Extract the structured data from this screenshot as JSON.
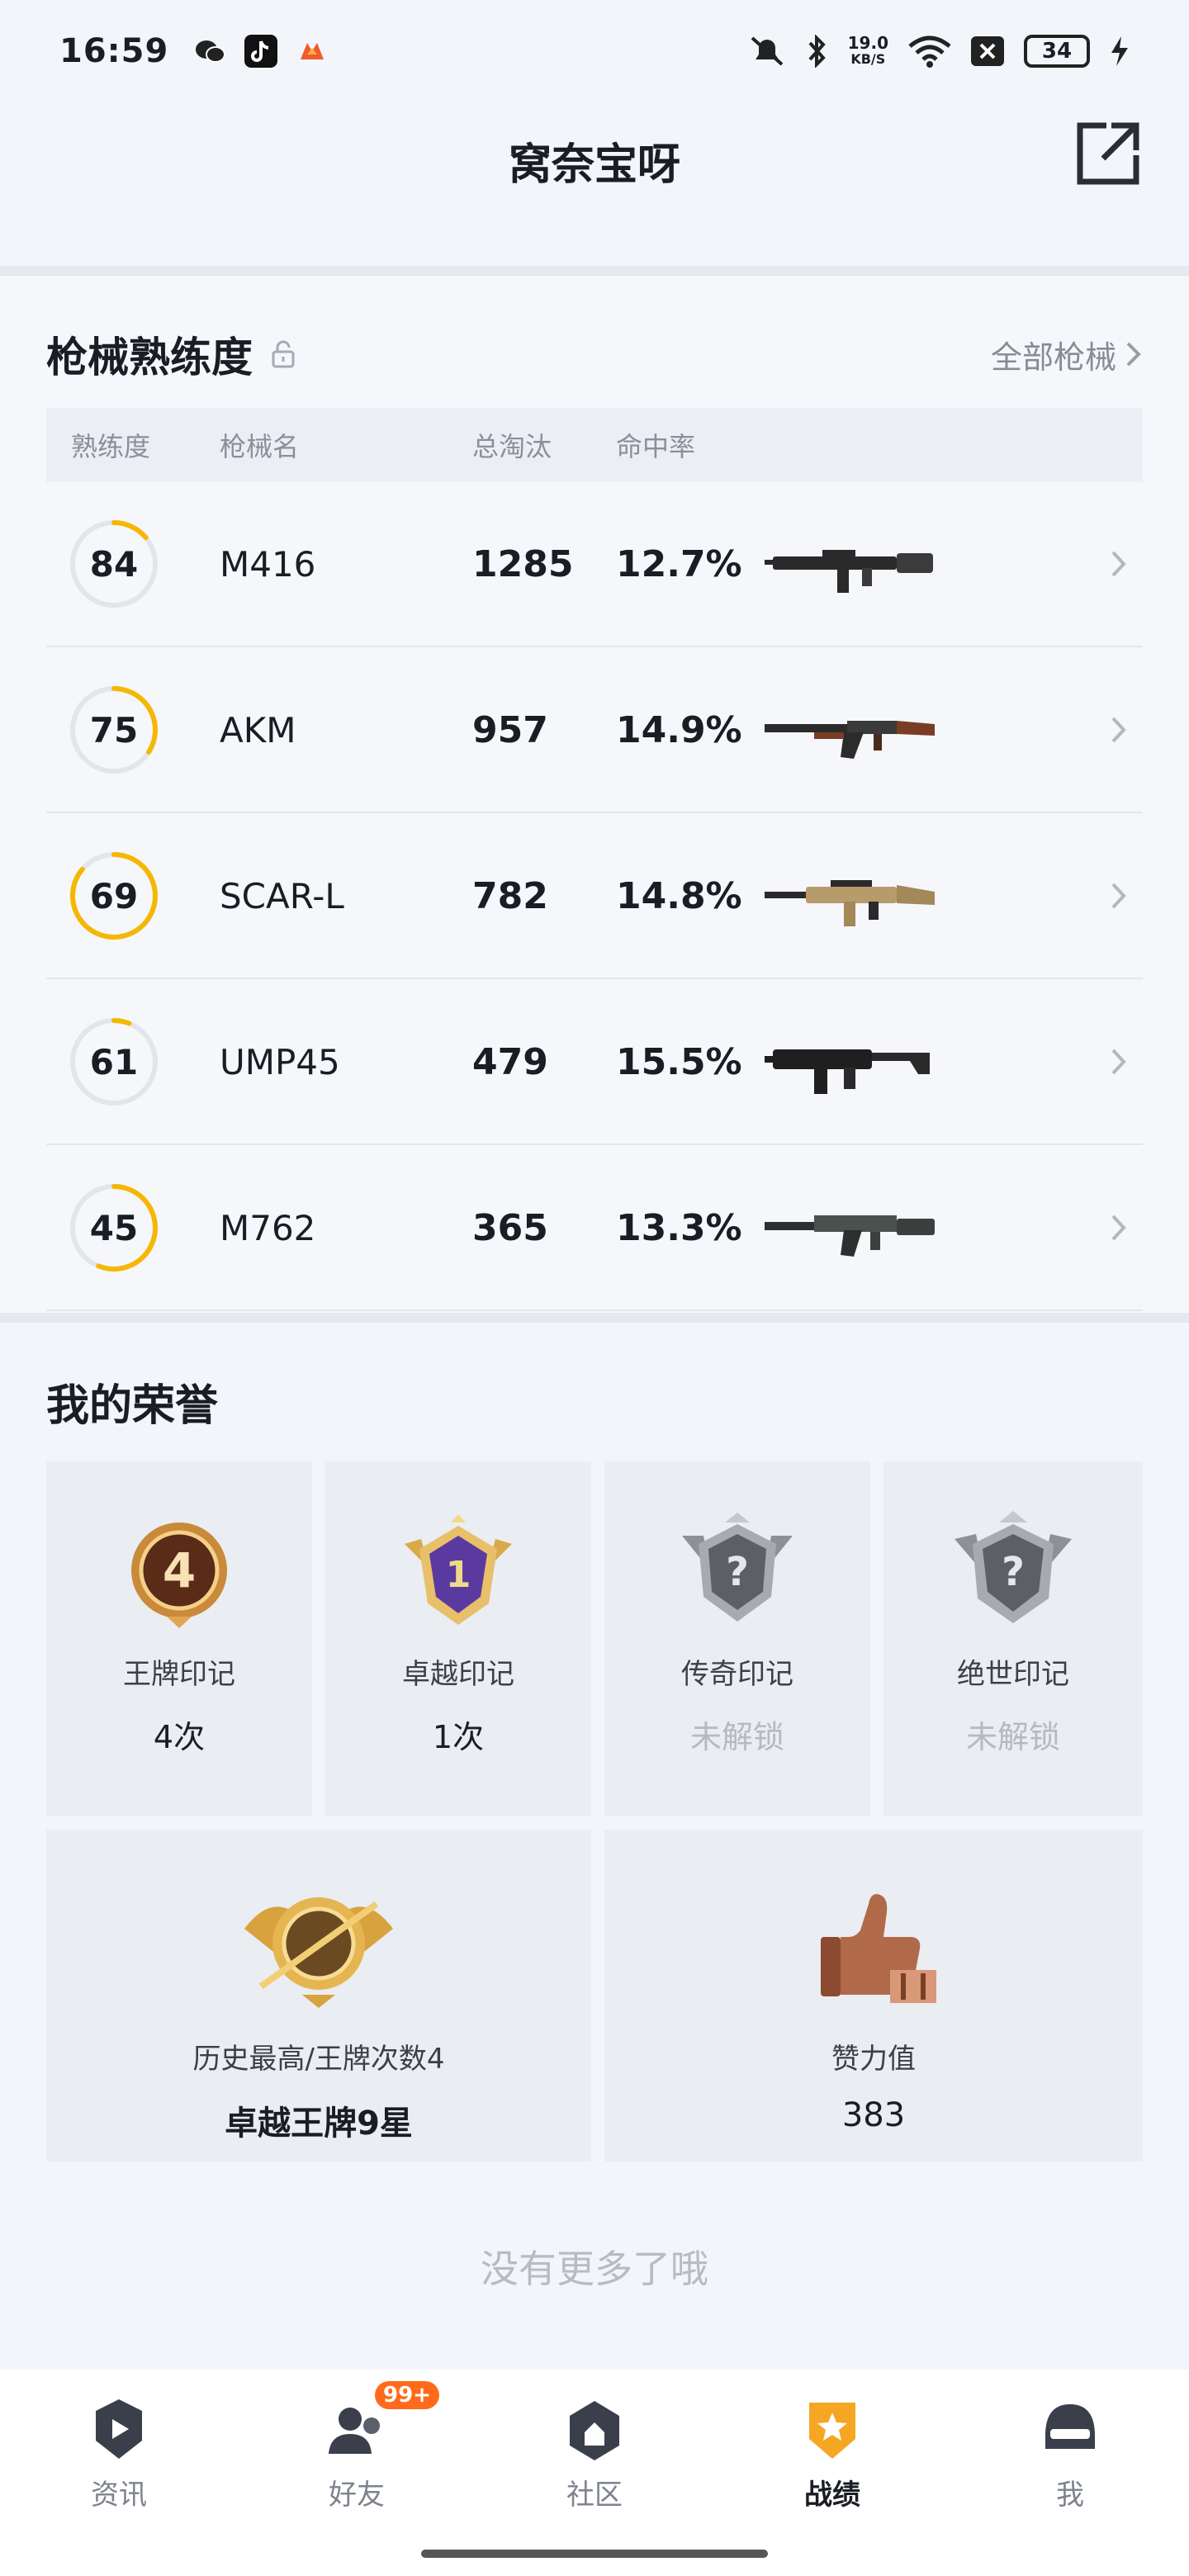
{
  "status_bar": {
    "time": "16:59",
    "net_speed_value": "19.0",
    "net_speed_unit": "KB/S",
    "battery": "34",
    "apps": [
      "wechat-icon",
      "douyin-icon",
      "game-app-icon"
    ],
    "icons": [
      "mute-icon",
      "bluetooth-icon",
      "wifi-icon",
      "sim-off-icon",
      "charging-icon"
    ]
  },
  "header": {
    "title": "窝奈宝呀",
    "share_icon": "share-external-icon"
  },
  "weapons": {
    "title": "枪械熟练度",
    "all_link": "全部枪械",
    "columns": {
      "mastery": "熟练度",
      "name": "枪械名",
      "kills": "总淘汰",
      "rate": "命中率"
    },
    "accent_color": "#f5b700",
    "rows": [
      {
        "mastery": "84",
        "progress": 0.14,
        "name": "M416",
        "kills": "1285",
        "rate": "12.7%",
        "gun": "m416"
      },
      {
        "mastery": "75",
        "progress": 0.34,
        "name": "AKM",
        "kills": "957",
        "rate": "14.9%",
        "gun": "akm"
      },
      {
        "mastery": "69",
        "progress": 0.86,
        "name": "SCAR-L",
        "kills": "782",
        "rate": "14.8%",
        "gun": "scar"
      },
      {
        "mastery": "61",
        "progress": 0.06,
        "name": "UMP45",
        "kills": "479",
        "rate": "15.5%",
        "gun": "ump"
      },
      {
        "mastery": "45",
        "progress": 0.56,
        "name": "M762",
        "kills": "365",
        "rate": "13.3%",
        "gun": "m762"
      }
    ]
  },
  "honors": {
    "title": "我的荣誉",
    "tiles": [
      {
        "label": "王牌印记",
        "value": "4次",
        "badge": "ace-mark-badge-icon",
        "unlocked": true
      },
      {
        "label": "卓越印记",
        "value": "1次",
        "badge": "excellence-mark-badge-icon",
        "unlocked": true
      },
      {
        "label": "传奇印记",
        "value": "未解锁",
        "badge": "legend-mark-badge-icon",
        "unlocked": false
      },
      {
        "label": "绝世印记",
        "value": "未解锁",
        "badge": "peerless-mark-badge-icon",
        "unlocked": false
      }
    ],
    "big_tiles": [
      {
        "label": "历史最高/王牌次数4",
        "value": "卓越王牌9星",
        "badge": "rank-tier-badge-icon"
      },
      {
        "label": "赞力值",
        "value": "383",
        "badge": "thumbs-up-trophy-icon"
      }
    ]
  },
  "no_more_text": "没有更多了哦",
  "bottom_nav": {
    "items": [
      {
        "label": "资讯",
        "icon": "news-icon"
      },
      {
        "label": "好友",
        "icon": "friends-icon",
        "badge": "99+"
      },
      {
        "label": "社区",
        "icon": "community-icon"
      },
      {
        "label": "战绩",
        "icon": "stats-shield-icon",
        "active": true
      },
      {
        "label": "我",
        "icon": "profile-helmet-icon"
      }
    ]
  }
}
